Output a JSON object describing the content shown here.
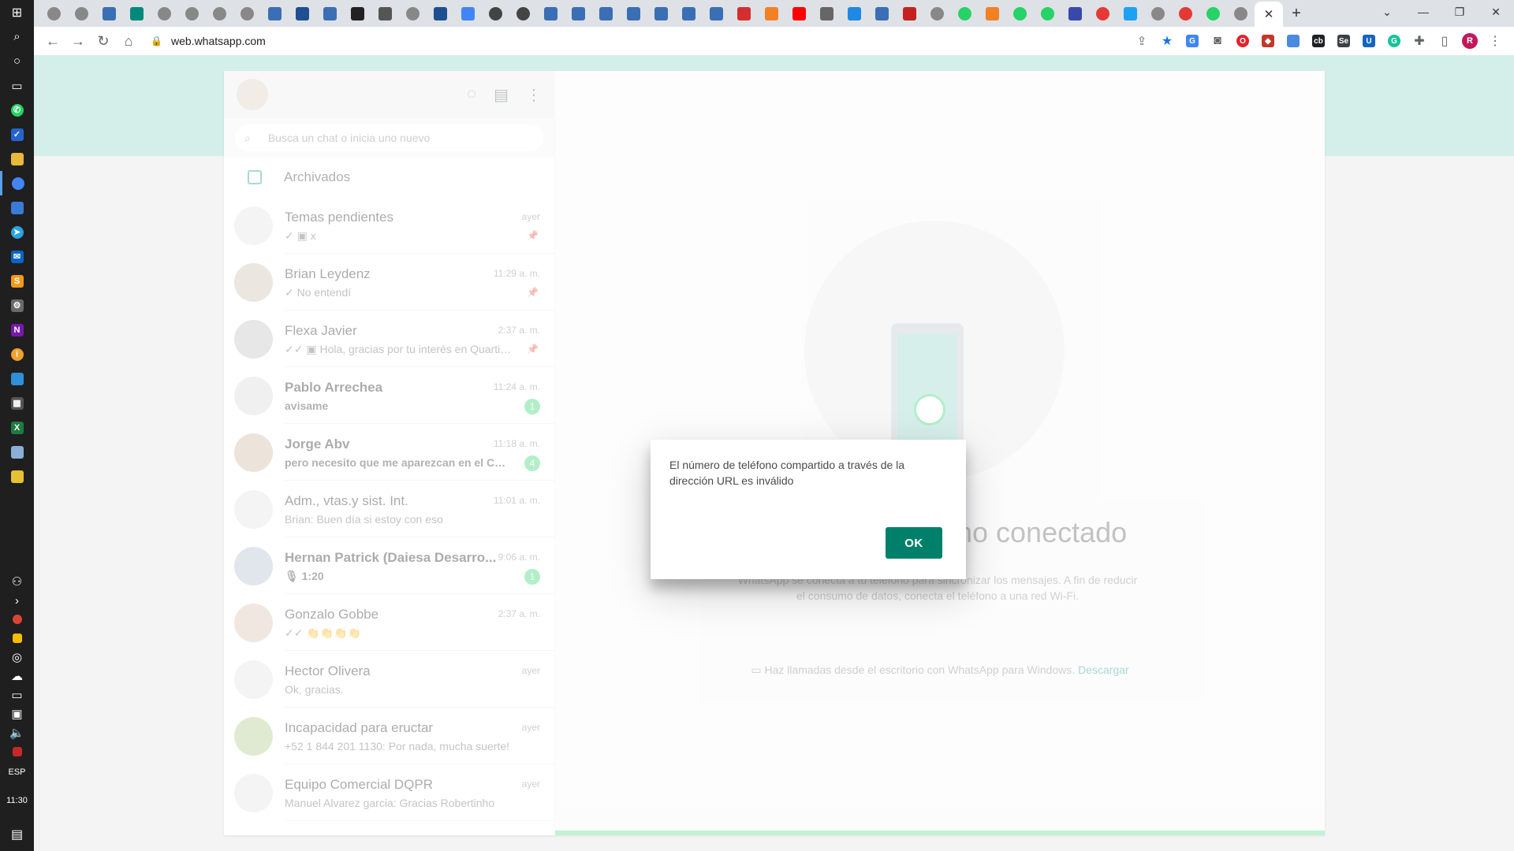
{
  "taskbar": {
    "language": "ESP",
    "time": "11:30"
  },
  "browser": {
    "url": "web.whatsapp.com",
    "tab_count_icons": [
      "chrome",
      "chrome",
      "tab",
      "meet",
      "chrome",
      "chrome",
      "chrome",
      "chrome",
      "tab",
      "ln",
      "tab",
      "github",
      "calc",
      "chrome",
      "ln",
      "google",
      "search",
      "search",
      "tab",
      "tab",
      "tab",
      "tab",
      "tab",
      "tab",
      "tab",
      "adobe",
      "stack",
      "youtube",
      "wikipedia",
      "c",
      "tab",
      "gmail",
      "chrome",
      "whatsapp",
      "stack",
      "whatsapp",
      "whatsapp",
      "n",
      "red",
      "twitter",
      "chrome",
      "red",
      "whatsapp",
      "chrome"
    ],
    "active_tab_close": "✕",
    "new_tab": "+",
    "window_controls": {
      "minimize": "—",
      "restore": "❐",
      "close": "✕"
    },
    "profile_initial": "R"
  },
  "whatsapp": {
    "search_placeholder": "Busca un chat o inicia uno nuevo",
    "archived_label": "Archivados",
    "chats": [
      {
        "name": "Temas pendientes",
        "preview": "✓ ▣ x",
        "time": "ayer",
        "bold": false,
        "pinned": true,
        "badge": ""
      },
      {
        "name": "Brian Leydenz",
        "preview": "✓ No entendí",
        "time": "11:29 a. m.",
        "bold": false,
        "pinned": true,
        "badge": ""
      },
      {
        "name": "Flexa Javier",
        "preview": "✓✓ ▣ Hola, gracias por tu interés en Quartier B...",
        "time": "2:37 a. m.",
        "bold": false,
        "pinned": true,
        "badge": ""
      },
      {
        "name": "Pablo Arrechea",
        "preview": "avisame",
        "time": "11:24 a. m.",
        "bold": true,
        "pinned": false,
        "badge": "1"
      },
      {
        "name": "Jorge Abv",
        "preview": "pero necesito que me aparezcan en el CRM ...",
        "time": "11:18 a. m.",
        "bold": true,
        "pinned": false,
        "badge": "4"
      },
      {
        "name": "Adm., vtas.y sist. Int.",
        "preview": "Brian: Buen día si estoy con eso",
        "time": "11:01 a. m.",
        "bold": false,
        "pinned": false,
        "badge": ""
      },
      {
        "name": "Hernan Patrick (Daiesa Desarro...",
        "preview": "🎙 1:20",
        "time": "9:06 a. m.",
        "bold": true,
        "pinned": false,
        "badge": "1"
      },
      {
        "name": "Gonzalo Gobbe",
        "preview": "✓✓ 👏👏👏👏",
        "time": "2:37 a. m.",
        "bold": false,
        "pinned": false,
        "badge": ""
      },
      {
        "name": "Hector Olivera",
        "preview": "Ok, gracias.",
        "time": "ayer",
        "bold": false,
        "pinned": false,
        "badge": ""
      },
      {
        "name": "Incapacidad para eructar",
        "preview": "+52 1 844 201 1130: Por nada, mucha suerte!",
        "time": "ayer",
        "bold": false,
        "pinned": false,
        "badge": ""
      },
      {
        "name": "Equipo Comercial DQPR",
        "preview": "Manuel Alvarez garcia: Gracias Robertinho",
        "time": "ayer",
        "bold": false,
        "pinned": false,
        "badge": ""
      }
    ],
    "main": {
      "title": "Mantén tu teléfono conectado",
      "description": "WhatsApp se conecta a tu teléfono para sincronizar los mensajes. A fin de reducir el consumo de datos, conecta el teléfono a una red Wi-Fi.",
      "calls_text": "Haz llamadas desde el escritorio con WhatsApp para Windows.",
      "calls_link": "Descargar"
    },
    "modal": {
      "message": "El número de teléfono compartido a través de la dirección URL es inválido",
      "ok_label": "OK"
    }
  },
  "colors": {
    "accent": "#00806a",
    "band": "#d4efea",
    "badge": "#25d366"
  }
}
